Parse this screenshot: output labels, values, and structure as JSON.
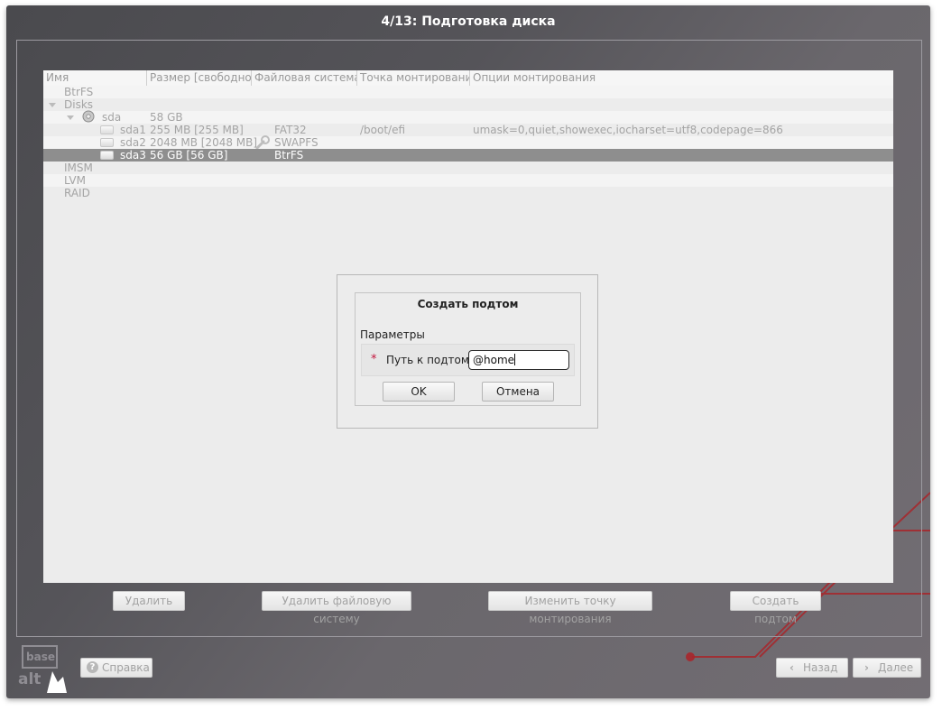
{
  "window": {
    "title": "4/13: Подготовка диска"
  },
  "tree": {
    "columns": [
      "Имя",
      "Размер [свободно]",
      "Файловая система",
      "Точка монтирования",
      "Опции монтирования"
    ],
    "rows": [
      {
        "name": "BtrFS",
        "size": "",
        "fs": "",
        "mount": "",
        "options": ""
      },
      {
        "name": "Disks",
        "size": "",
        "fs": "",
        "mount": "",
        "options": ""
      },
      {
        "name": "sda",
        "size": "58 GB",
        "fs": "",
        "mount": "",
        "options": ""
      },
      {
        "name": "sda1",
        "size": "255 MB [255 MB]",
        "fs": "FAT32",
        "mount": "/boot/efi",
        "options": "umask=0,quiet,showexec,iocharset=utf8,codepage=866"
      },
      {
        "name": "sda2",
        "size": "2048 MB [2048 MB]",
        "fs": "SWAPFS",
        "mount": "",
        "options": ""
      },
      {
        "name": "sda3",
        "size": "56 GB [56 GB]",
        "fs": "BtrFS",
        "mount": "",
        "options": ""
      },
      {
        "name": "IMSM",
        "size": "",
        "fs": "",
        "mount": "",
        "options": ""
      },
      {
        "name": "LVM",
        "size": "",
        "fs": "",
        "mount": "",
        "options": ""
      },
      {
        "name": "RAID",
        "size": "",
        "fs": "",
        "mount": "",
        "options": ""
      }
    ],
    "selected_row": "sda3"
  },
  "dialog": {
    "title": "Создать подтом",
    "section": "Параметры",
    "required_marker": "*",
    "field_label": "Путь к подтому",
    "field_value": "@home",
    "ok_label": "OK",
    "cancel_label": "Отмена"
  },
  "actions": {
    "delete_label": "Удалить",
    "delete_fs_label": "Удалить файловую систему",
    "change_mount_label": "Изменить точку монтирования",
    "create_subvol_label": "Создать подтом"
  },
  "footer": {
    "help_label": "Справка",
    "back_label": "Назад",
    "next_label": "Далее",
    "back_icon": "chevron-left-icon",
    "next_icon": "chevron-right-icon"
  },
  "logo": {
    "text_top": "base",
    "text_bottom": "alt"
  },
  "colors": {
    "accent_circuit": "#b0282c",
    "selection": "#8e8e8e",
    "required": "#c3143c"
  }
}
